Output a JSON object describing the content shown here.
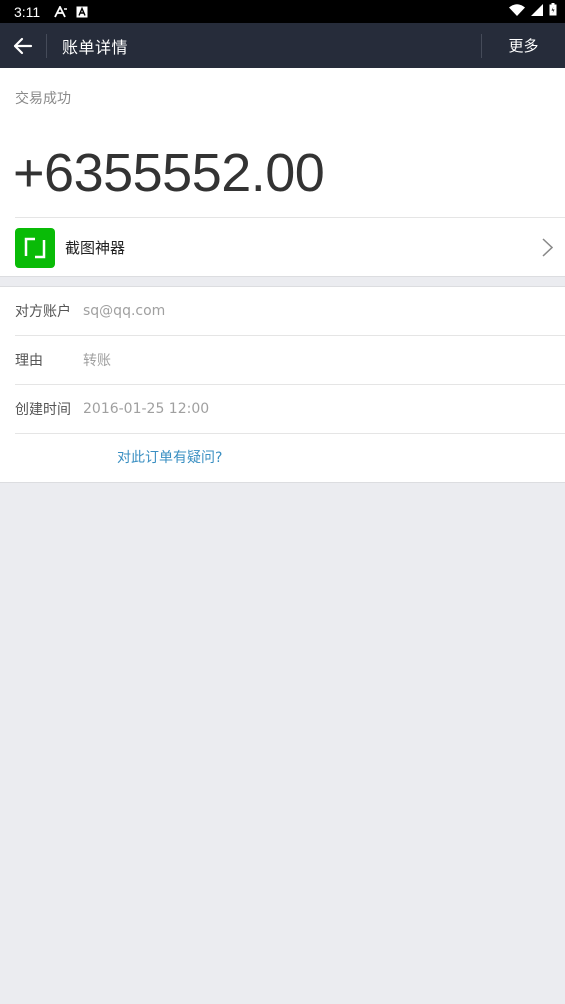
{
  "status_bar": {
    "time": "3:11"
  },
  "header": {
    "title": "账单详情",
    "more_label": "更多"
  },
  "transaction": {
    "status": "交易成功",
    "amount": "+6355552.00",
    "merchant": "截图神器"
  },
  "details": [
    {
      "label": "对方账户",
      "value": "sq@qq.com"
    },
    {
      "label": "理由",
      "value": "转账"
    },
    {
      "label": "创建时间",
      "value": "2016-01-25 12:00"
    }
  ],
  "question_link": "对此订单有疑问?",
  "colors": {
    "header_bg": "#262c3a",
    "merchant_icon_bg": "#09bb07",
    "link": "#3a8fc2",
    "page_bg": "#ebecf0"
  }
}
